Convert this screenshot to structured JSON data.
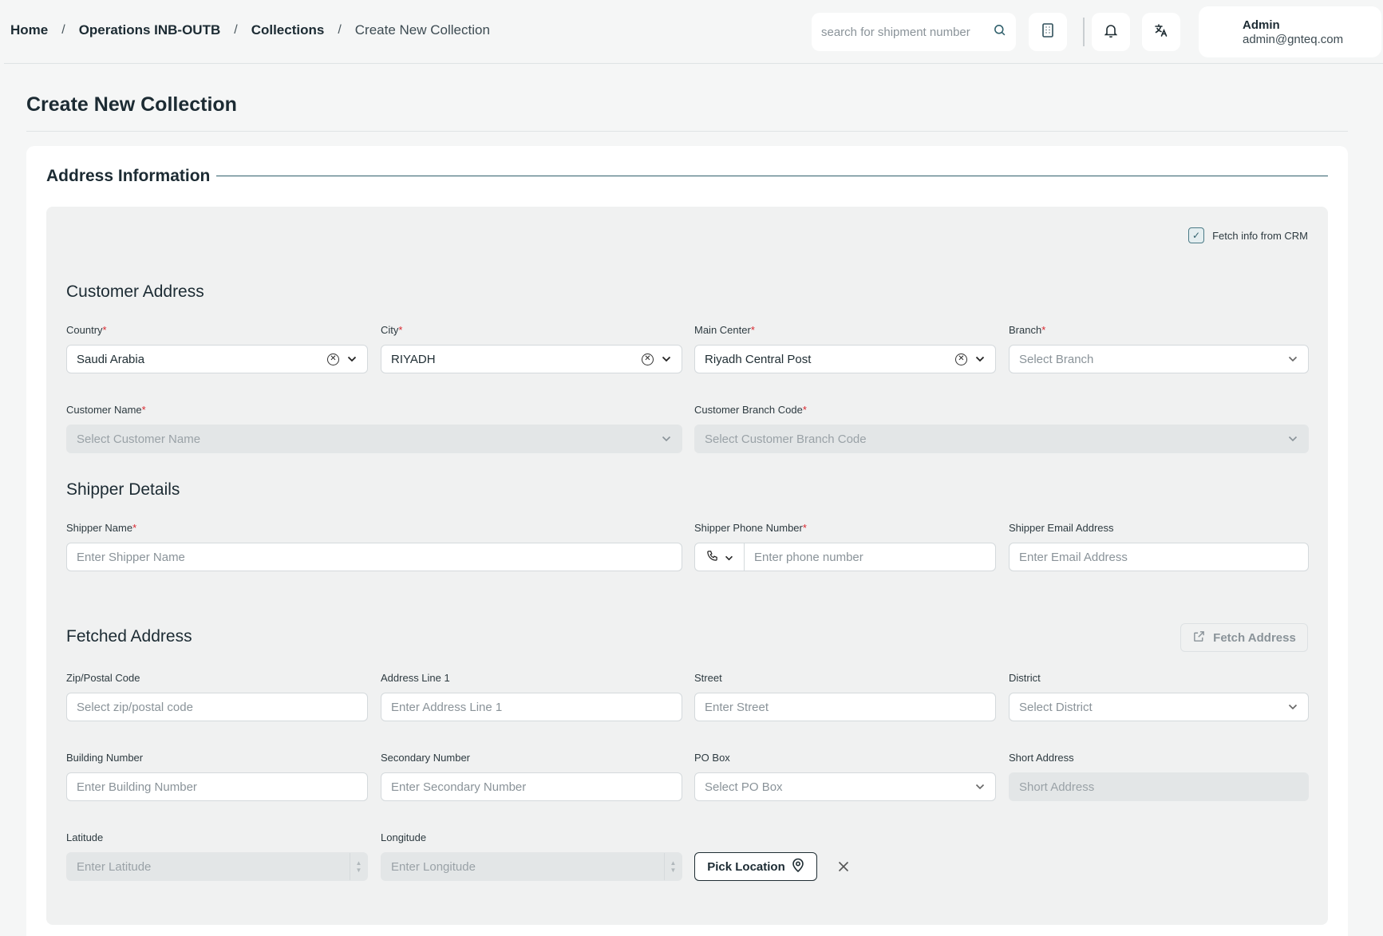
{
  "breadcrumb": {
    "home": "Home",
    "operations": "Operations INB-OUTB",
    "collections": "Collections",
    "current": "Create New Collection"
  },
  "search": {
    "placeholder": "search for shipment number"
  },
  "user": {
    "name": "Admin",
    "email": "admin@gnteq.com"
  },
  "page": {
    "title": "Create New Collection"
  },
  "address_info": {
    "title": "Address Information",
    "fetch_crm_label": "Fetch info from CRM",
    "fetch_crm_checked": true
  },
  "customer_address": {
    "title": "Customer Address",
    "country": {
      "label": "Country",
      "value": "Saudi Arabia"
    },
    "city": {
      "label": "City",
      "value": "RIYADH"
    },
    "main_center": {
      "label": "Main Center",
      "value": "Riyadh Central Post"
    },
    "branch": {
      "label": "Branch",
      "placeholder": "Select Branch"
    },
    "customer_name": {
      "label": "Customer Name",
      "placeholder": "Select Customer Name"
    },
    "customer_branch_code": {
      "label": "Customer Branch Code",
      "placeholder": "Select Customer Branch Code"
    }
  },
  "shipper": {
    "title": "Shipper Details",
    "name": {
      "label": "Shipper Name",
      "placeholder": "Enter Shipper Name"
    },
    "phone": {
      "label": "Shipper Phone Number",
      "placeholder": "Enter phone number"
    },
    "email": {
      "label": "Shipper Email Address",
      "placeholder": "Enter Email Address"
    }
  },
  "fetched_address": {
    "title": "Fetched Address",
    "fetch_button": "Fetch Address",
    "zip": {
      "label": "Zip/Postal Code",
      "placeholder": "Select zip/postal code"
    },
    "address_line1": {
      "label": "Address Line 1",
      "placeholder": "Enter Address Line 1"
    },
    "street": {
      "label": "Street",
      "placeholder": "Enter Street"
    },
    "district": {
      "label": "District",
      "placeholder": "Select District"
    },
    "building_number": {
      "label": "Building Number",
      "placeholder": "Enter Building Number"
    },
    "secondary_number": {
      "label": "Secondary Number",
      "placeholder": "Enter Secondary Number"
    },
    "po_box": {
      "label": "PO Box",
      "placeholder": "Select PO Box"
    },
    "short_address": {
      "label": "Short Address",
      "placeholder": "Short Address"
    },
    "latitude": {
      "label": "Latitude",
      "placeholder": "Enter Latitude"
    },
    "longitude": {
      "label": "Longitude",
      "placeholder": "Enter Longitude"
    },
    "pick_location": "Pick Location"
  },
  "colors": {
    "accent": "#2f5f6b",
    "required": "#d9282f",
    "page_bg": "#f5f6f6",
    "panel_bg": "#f0f1f1"
  }
}
